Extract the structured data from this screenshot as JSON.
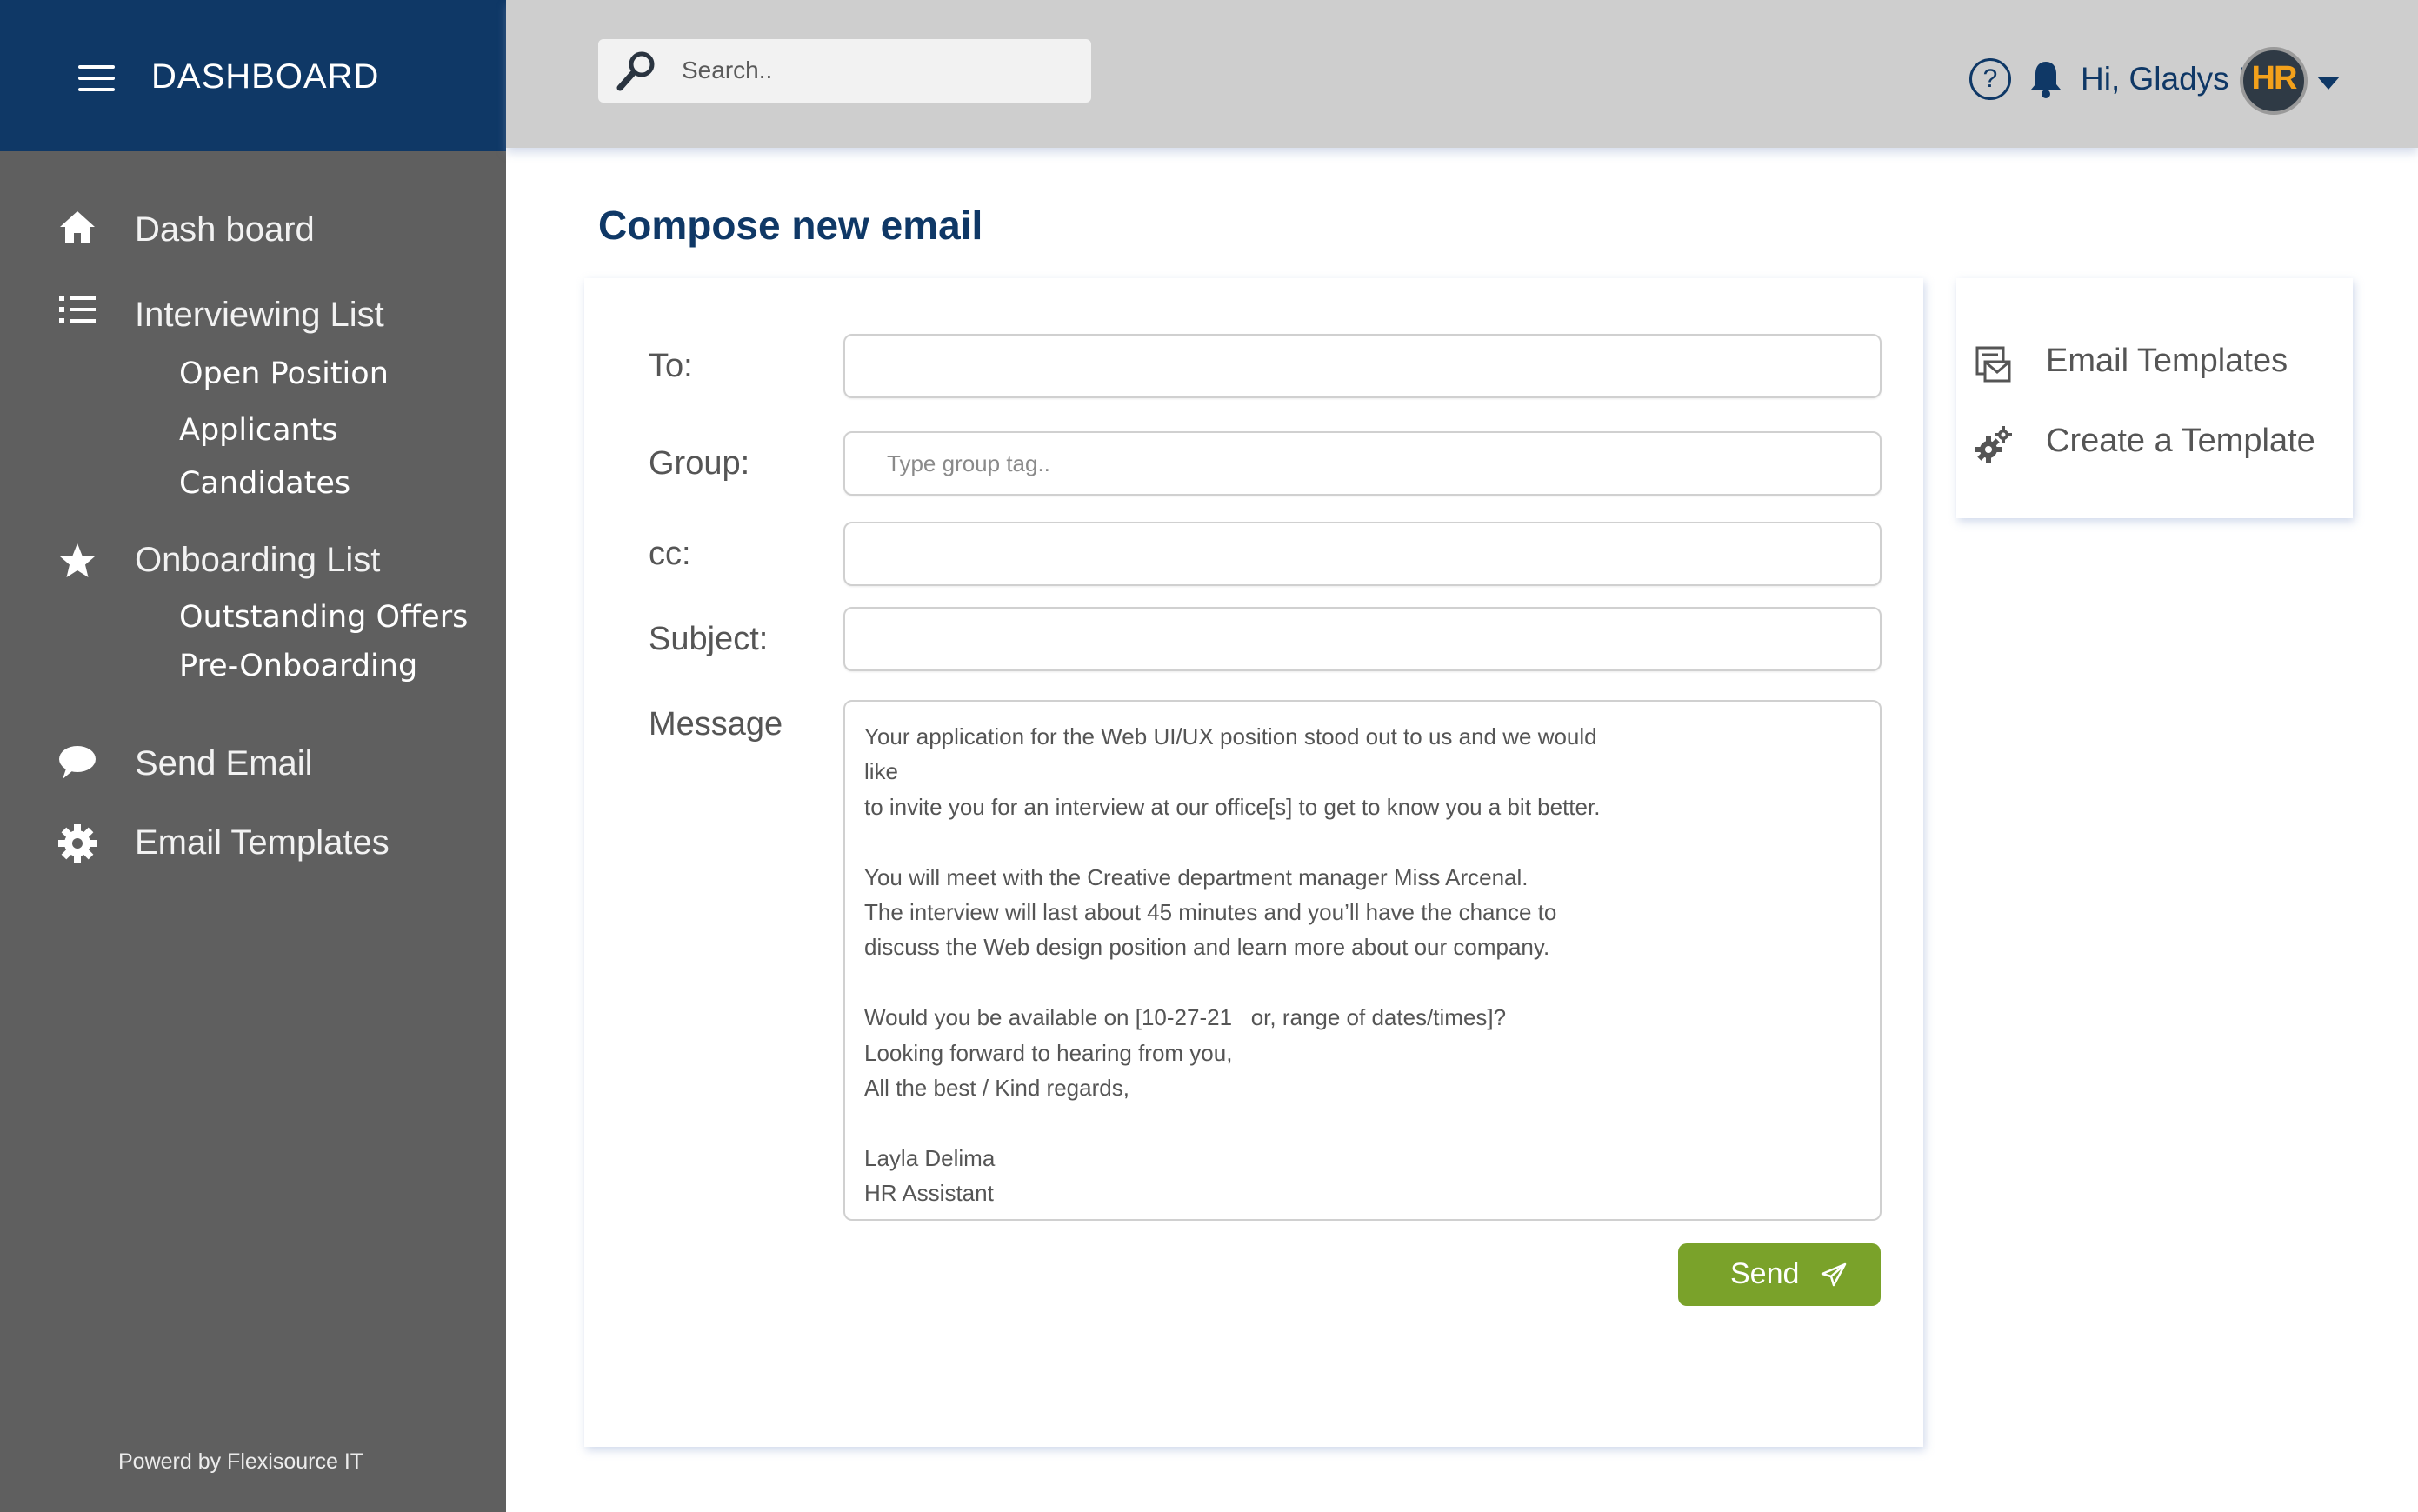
{
  "brand": {
    "title": "DASHBOARD"
  },
  "sidebar": {
    "items": [
      {
        "label": "Dash board",
        "icon": "home-icon"
      },
      {
        "label": "Interviewing List",
        "icon": "list-icon",
        "children": [
          "Open Position",
          "Applicants",
          "Candidates"
        ]
      },
      {
        "label": "Onboarding List",
        "icon": "star-icon",
        "children": [
          "Outstanding Offers",
          "Pre-Onboarding"
        ]
      },
      {
        "label": "Send Email",
        "icon": "chat-bubble-icon"
      },
      {
        "label": "Email Templates",
        "icon": "gear-icon"
      }
    ],
    "powered_by": "Powerd by Flexisource IT"
  },
  "header": {
    "search_placeholder": "Search..",
    "help_symbol": "?",
    "greeting": "Hi, Gladys !",
    "avatar_text": "HR"
  },
  "main": {
    "title": "Compose new email",
    "form": {
      "to_label": "To:",
      "to_value": "",
      "group_label": "Group:",
      "group_placeholder": "Type group tag..",
      "cc_label": "cc:",
      "cc_value": "",
      "subject_label": "Subject:",
      "subject_value": "",
      "message_label": "Message",
      "message_lines": [
        "Your application for the Web UI/UX position stood out to us and we would",
        "like",
        "to invite you for an interview at our office[s] to get to know you a bit better.",
        "",
        "You will meet with the Creative department manager Miss Arcenal.",
        "The interview will last about 45 minutes and you’ll have the chance to",
        "discuss the Web design position and learn more about our company.",
        "",
        "Would you be available on [10-27-21   or, range of dates/times]?",
        "Looking forward to hearing from you,",
        "All the best / Kind regards,",
        "",
        "Layla Delima",
        "HR Assistant"
      ],
      "send_label": "Send"
    }
  },
  "templates_panel": {
    "items": [
      {
        "label": "Email Templates",
        "icon": "mail-template-icon"
      },
      {
        "label": "Create a Template",
        "icon": "gears-icon"
      }
    ]
  },
  "colors": {
    "brand_navy": "#0f3866",
    "sidebar_gray": "#5f5f5f",
    "topbar_gray": "#cecece",
    "send_green": "#7aa22a",
    "avatar_orange": "#f3a11b"
  }
}
